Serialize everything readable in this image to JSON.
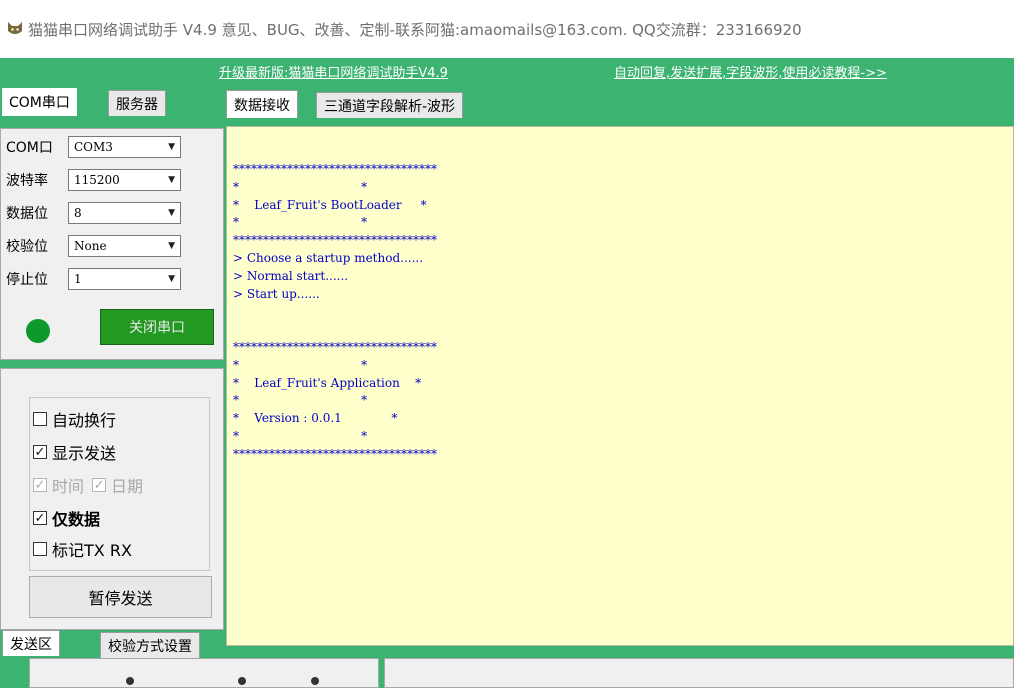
{
  "window": {
    "title": "猫猫串口网络调试助手 V4.9 意见、BUG、改善、定制-联系阿猫:amaomails@163.com. QQ交流群：233166920",
    "icon": "cat-icon"
  },
  "links": {
    "upgrade": "升级最新版:猫猫串口网络调试助手V4.9",
    "tutorial": "自动回复,发送扩展,字段波形,使用必读教程->>"
  },
  "left_tabs": [
    "COM串口",
    "服务器"
  ],
  "right_tabs": [
    "数据接收",
    "三通道字段解析-波形"
  ],
  "serial_settings": [
    {
      "label": "COM口",
      "value": "COM3"
    },
    {
      "label": "波特率",
      "value": "115200"
    },
    {
      "label": "数据位",
      "value": "8"
    },
    {
      "label": "校验位",
      "value": "None"
    },
    {
      "label": "停止位",
      "value": "1"
    }
  ],
  "status": {
    "led_color": "#0e9a2a"
  },
  "close_port_label": "关闭串口",
  "options": {
    "auto_wrap": "自动换行",
    "show_send": "显示发送",
    "time": "时间",
    "date": "日期",
    "data_only": "仅数据",
    "mark_tx_rx": "标记TX RX"
  },
  "pause_send_label": "暂停发送",
  "bottom_tabs": [
    "发送区",
    "校验方式设置"
  ],
  "receive_text": "**********************************\n*                                *\n*    Leaf_Fruit's BootLoader     *\n*                                *\n**********************************\n> Choose a startup method......\n> Normal start......\n> Start up......\n\n\n**********************************\n*                                *\n*    Leaf_Fruit's Application    *\n*                                *\n*    Version : 0.0.1             *\n*                                *\n**********************************",
  "colors": {
    "panel_green": "#3cb371",
    "receive_bg": "#ffffcc",
    "receive_text": "#0000c8"
  }
}
